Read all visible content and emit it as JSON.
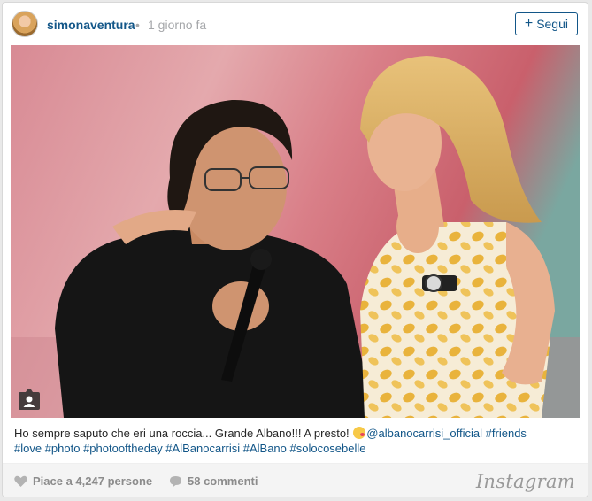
{
  "header": {
    "username": "simonaventura",
    "separator": "•",
    "time": "1 giorno fa",
    "follow_label": "Segui",
    "follow_icon": "plus-icon"
  },
  "photo": {
    "description_icon": "user-tag-icon"
  },
  "caption": {
    "text": "Ho sempre saputo che eri una roccia... Grande Albano!!! A presto!",
    "emoji": "kissing-face-emoji",
    "mention": "@albanocarrisi_official",
    "tags_line1": "#friends",
    "tags_line2": "#love #photo #photooftheday #AlBanocarrisi #AlBano #solocosebelle"
  },
  "footer": {
    "likes": "Piace a 4,247 persone",
    "comments": "58 commenti",
    "brand": "Instagram"
  },
  "colors": {
    "link": "#125688",
    "muted": "#a5a7aa",
    "footer_bg": "#f4f4f4"
  }
}
